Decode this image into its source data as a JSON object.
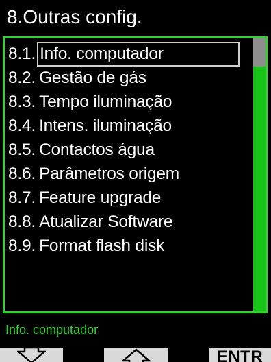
{
  "header": {
    "title": "8.Outras config."
  },
  "menu": {
    "selected_index": 0,
    "items": [
      {
        "number": "8.1.",
        "label": "Info. computador"
      },
      {
        "number": "8.2.",
        "label": "Gestão de gás"
      },
      {
        "number": "8.3.",
        "label": "Tempo iluminação"
      },
      {
        "number": "8.4.",
        "label": "Intens. iluminação"
      },
      {
        "number": "8.5.",
        "label": "Contactos água"
      },
      {
        "number": "8.6.",
        "label": "Parâmetros origem"
      },
      {
        "number": "8.7.",
        "label": "Feature upgrade"
      },
      {
        "number": "8.8.",
        "label": "Atualizar Software"
      },
      {
        "number": "8.9.",
        "label": "Format flash disk"
      }
    ]
  },
  "status": {
    "text": "Info. computador"
  },
  "softkeys": {
    "left_icon": "arrow-down-icon",
    "middle_icon": "arrow-up-icon",
    "right_label": "ENTR"
  },
  "colors": {
    "accent": "#2fd42f",
    "scroll_track": "#17c417",
    "scroll_thumb": "#8e8e8e",
    "background": "#000000",
    "text": "#ffffff",
    "softkey_bg": "#d9d9d9"
  }
}
